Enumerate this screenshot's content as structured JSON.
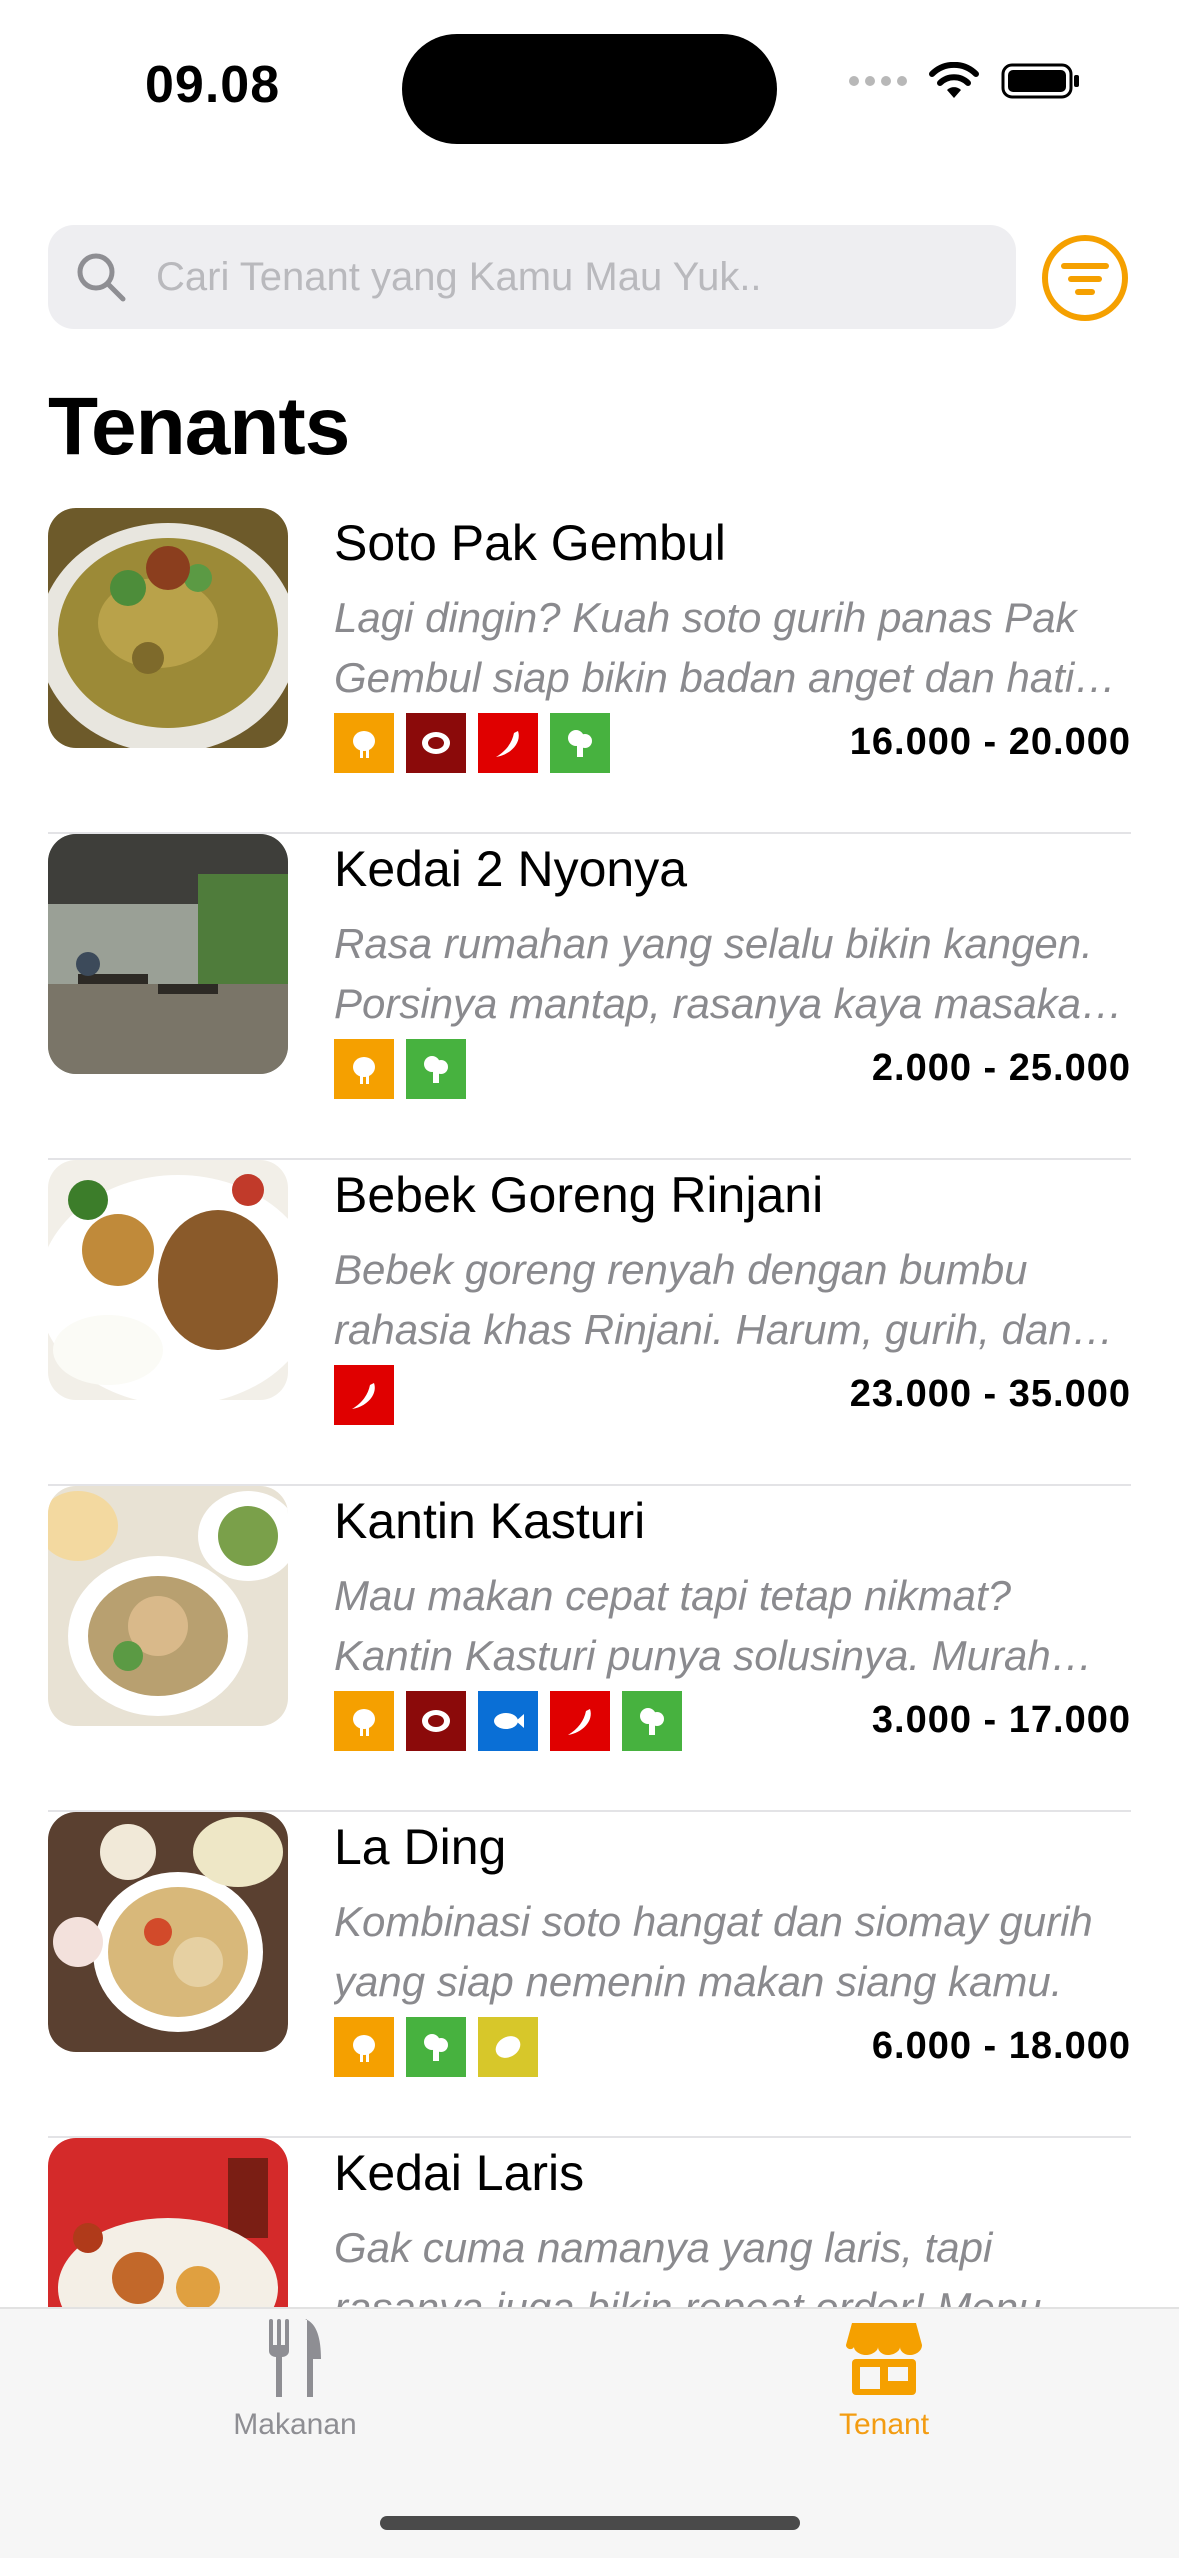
{
  "status_bar": {
    "time": "09.08"
  },
  "search": {
    "placeholder": "Cari Tenant yang Kamu Mau Yuk.."
  },
  "page_title": "Tenants",
  "colors": {
    "accent": "#F5A000",
    "chicken": "#F5A000",
    "beef": "#8B0A0A",
    "fish": "#0A6FD6",
    "spicy": "#E00000",
    "veg": "#47B23F",
    "egg": "#D7C72A"
  },
  "tenants": [
    {
      "name": "Soto Pak Gembul",
      "description": "Lagi dingin? Kuah soto gurih panas Pak Gembul siap bikin badan anget dan hati senang.",
      "price": "16.000 - 20.000",
      "tags": [
        "chicken-icon",
        "beef-icon",
        "chili-icon",
        "broccoli-icon"
      ]
    },
    {
      "name": "Kedai 2 Nyonya",
      "description": "Rasa rumahan yang selalu bikin kangen. Porsinya mantap, rasanya kaya masakan ibu.",
      "price": "2.000 - 25.000",
      "tags": [
        "chicken-icon",
        "broccoli-icon"
      ]
    },
    {
      "name": "Bebek Goreng Rinjani",
      "description": "Bebek goreng renyah dengan bumbu rahasia khas Rinjani. Harum, gurih, dan bikin nagih.",
      "price": "23.000 - 35.000",
      "tags": [
        "chili-icon"
      ]
    },
    {
      "name": "Kantin Kasturi",
      "description": "Mau makan cepat tapi tetap nikmat? Kantin Kasturi punya solusinya. Murah dan enak.",
      "price": "3.000 - 17.000",
      "tags": [
        "chicken-icon",
        "beef-icon",
        "fish-icon",
        "chili-icon",
        "broccoli-icon"
      ]
    },
    {
      "name": "La Ding",
      "description": "Kombinasi soto hangat dan siomay gurih yang siap nemenin makan siang kamu.",
      "price": "6.000 - 18.000",
      "tags": [
        "chicken-icon",
        "broccoli-icon",
        "potato-icon"
      ]
    },
    {
      "name": "Kedai Laris",
      "description": "Gak cuma namanya yang laris, tapi rasanya juga bikin repeat order! Menu lengkap.",
      "price": "",
      "tags": []
    }
  ],
  "tabbar": {
    "tabs": [
      {
        "label": "Makanan",
        "icon": "fork-knife-icon",
        "active": false
      },
      {
        "label": "Tenant",
        "icon": "store-icon",
        "active": true
      }
    ]
  }
}
